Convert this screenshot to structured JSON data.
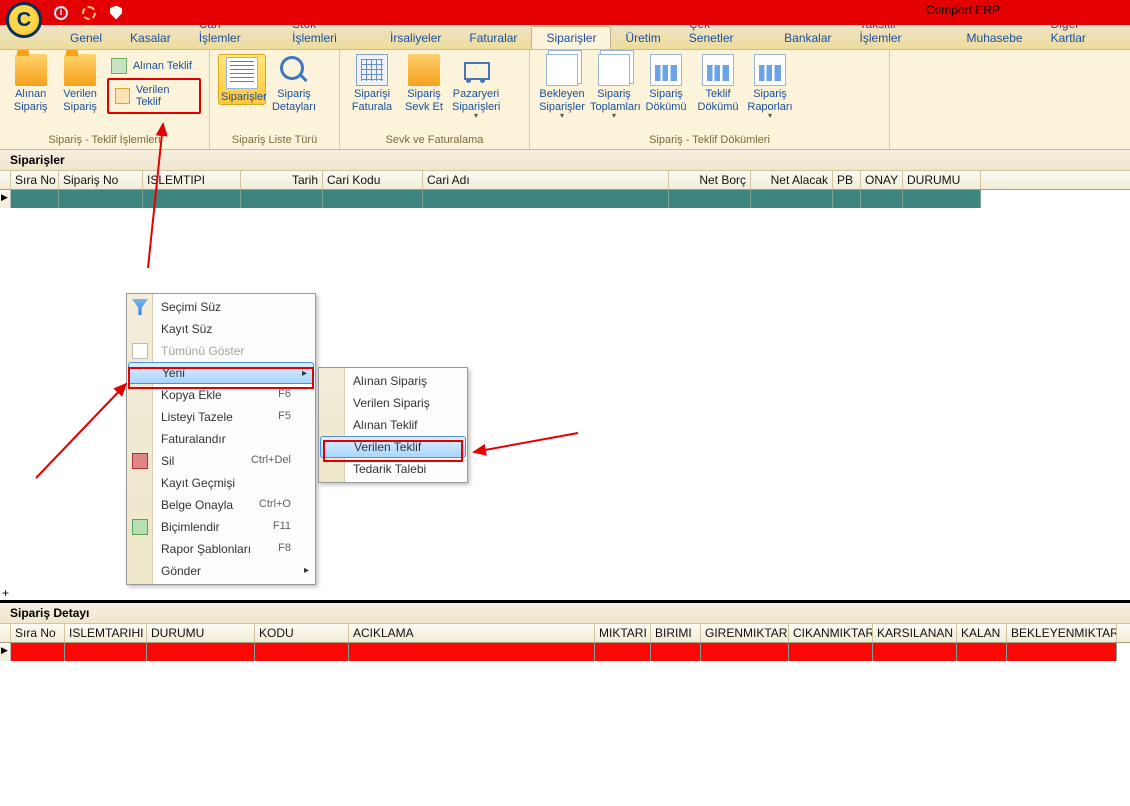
{
  "app": {
    "title": "Comport ERP",
    "logo_letter": "C"
  },
  "menu": {
    "tabs": [
      "Genel",
      "Kasalar",
      "Cari İşlemler",
      "Stok İşlemleri",
      "İrsaliyeler",
      "Faturalar",
      "Siparişler",
      "Üretim",
      "Çek Senetler",
      "Bankalar",
      "Taksitli İşlemler",
      "Muhasebe",
      "Diğer Kartlar"
    ],
    "active": "Siparişler"
  },
  "ribbon": {
    "g1": {
      "caption": "Sipariş - Teklif İşlemleri",
      "alinan_siparis": "Alınan Sipariş",
      "verilen_siparis": "Verilen Sipariş",
      "alinan_teklif": "Alınan Teklif",
      "verilen_teklif": "Verilen Teklif"
    },
    "g2": {
      "caption": "Sipariş Liste Türü",
      "siparisler": "Siparişler",
      "detaylari": "Sipariş Detayları"
    },
    "g3": {
      "caption": "Sevk ve Faturalama",
      "fatura": "Siparişi Faturala",
      "sevket": "Sipariş Sevk Et",
      "pazaryeri": "Pazaryeri Siparişleri"
    },
    "g4": {
      "caption": "Sipariş - Teklif Dökümleri",
      "bekleyen": "Bekleyen Siparişler",
      "toplam": "Sipariş Toplamları",
      "dokum": "Sipariş Dökümü",
      "teklif_dokum": "Teklif Dökümü",
      "raporlar": "Sipariş Raporları"
    }
  },
  "grid1": {
    "title": "Siparişler",
    "cols": [
      "Sıra No",
      "Sipariş No",
      "ISLEMTIPI",
      "Tarih",
      "Cari Kodu",
      "Cari Adı",
      "Net Borç",
      "Net Alacak",
      "PB",
      "ONAY",
      "DURUMU"
    ]
  },
  "ctx": {
    "secimi_suz": "Seçimi Süz",
    "kayit_suz": "Kayıt Süz",
    "tumunu": "Tümünü Göster",
    "yeni": "Yeni",
    "kopya": "Kopya Ekle",
    "kopya_sc": "F6",
    "tazele": "Listeyi Tazele",
    "tazele_sc": "F5",
    "faturalandir": "Faturalandır",
    "sil": "Sil",
    "sil_sc": "Ctrl+Del",
    "gecmis": "Kayıt Geçmişi",
    "onayla": "Belge Onayla",
    "onayla_sc": "Ctrl+O",
    "bicim": "Biçimlendir",
    "bicim_sc": "F11",
    "rapor": "Rapor Şablonları",
    "rapor_sc": "F8",
    "gonder": "Gönder"
  },
  "submenu": {
    "alinan_siparis": "Alınan Sipariş",
    "verilen_siparis": "Verilen Sipariş",
    "alinan_teklif": "Alınan Teklif",
    "verilen_teklif": "Verilen Teklif",
    "tedarik": "Tedarik Talebi"
  },
  "grid2": {
    "title": "Sipariş Detayı",
    "cols": [
      "Sıra No",
      "ISLEMTARIHI",
      "DURUMU",
      "KODU",
      "ACIKLAMA",
      "MIKTARI",
      "BIRIMI",
      "GIRENMIKTAR",
      "CIKANMIKTAR",
      "KARSILANAN",
      "KALAN",
      "BEKLEYENMIKTAR"
    ]
  }
}
